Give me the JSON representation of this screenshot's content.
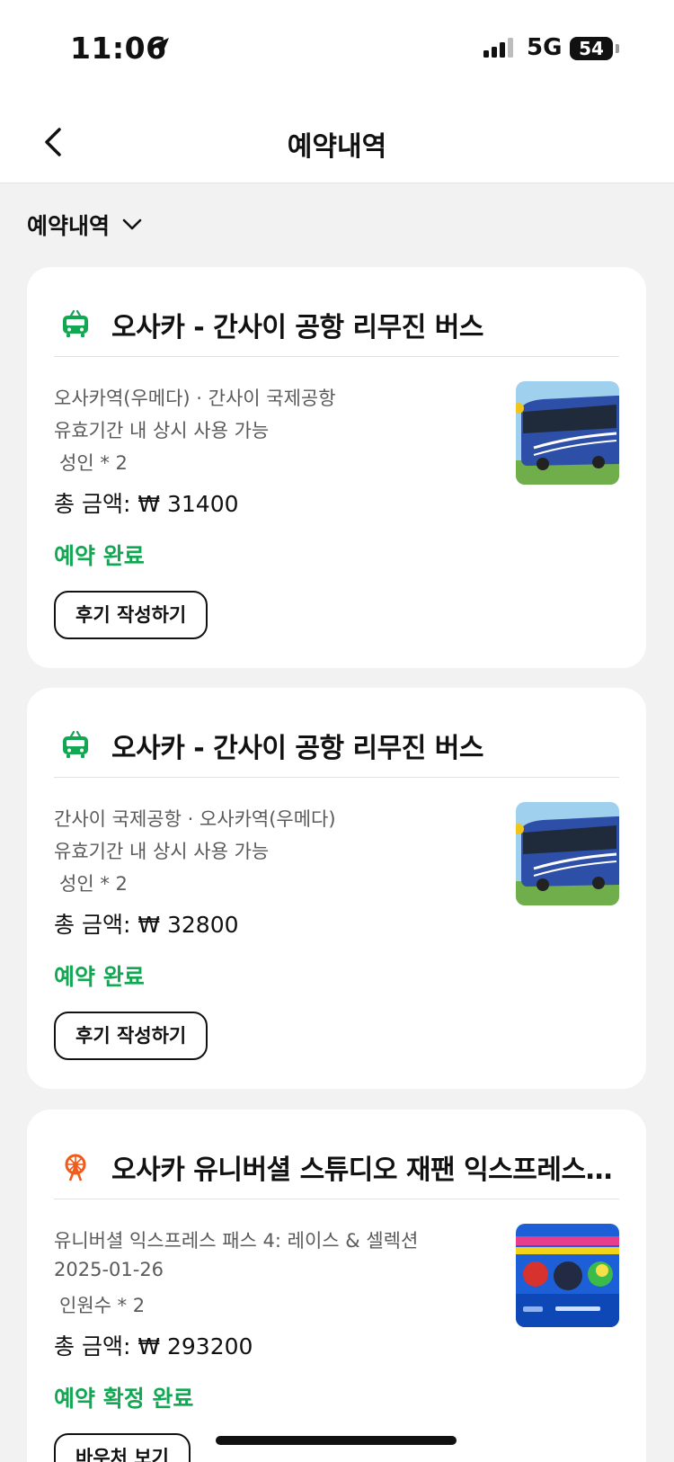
{
  "status_bar": {
    "time": "11:06",
    "network": "5G",
    "battery": "54"
  },
  "header": {
    "title": "예약내역"
  },
  "filter": {
    "label": "예약내역"
  },
  "bookings": [
    {
      "category_icon": "bus-icon",
      "title": "오사카 - 간사이 공항 리무진 버스",
      "route": "오사카역(우메다) · 간사이 국제공항",
      "validity": "유효기간 내 상시 사용 가능",
      "quantity": "성인 * 2",
      "total": "총 금액: ₩ 31400",
      "status": "예약 완료",
      "action": "후기 작성하기"
    },
    {
      "category_icon": "bus-icon",
      "title": "오사카 - 간사이 공항 리무진 버스",
      "route": "간사이 국제공항 · 오사카역(우메다)",
      "validity": "유효기간 내 상시 사용 가능",
      "quantity": "성인 * 2",
      "total": "총 금액: ₩ 32800",
      "status": "예약 완료",
      "action": "후기 작성하기"
    },
    {
      "category_icon": "ferris-wheel-icon",
      "title": "오사카 유니버셜 스튜디오 재팬 익스프레스 패스",
      "route": "유니버셜 익스프레스 패스 4: 레이스 & 셀렉션",
      "validity": "2025-01-26",
      "quantity": "인원수 * 2",
      "total": "총 금액: ₩ 293200",
      "status": "예약 확정 완료",
      "action": "바우처 보기"
    }
  ],
  "colors": {
    "accent_green": "#12a853",
    "bus_icon": "#12a853",
    "theme_park_icon": "#f05a1a",
    "background": "#f2f2f2"
  }
}
